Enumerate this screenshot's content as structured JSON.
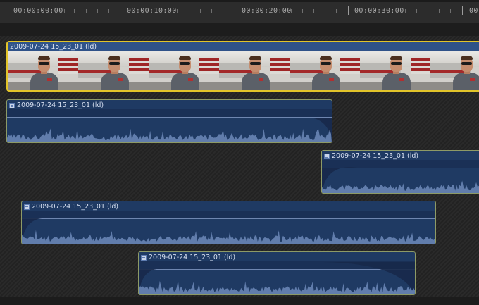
{
  "ruler": {
    "timecodes": [
      "00:00:00:00",
      "00:00:10:00",
      "00:00:20:00",
      "00:00:30:00",
      "00"
    ]
  },
  "video_clip": {
    "name": "2009-07-24 15_23_01 (ld)",
    "thumbnail_count": 7
  },
  "audio_clips": [
    {
      "name": "2009-07-24 15_23_01 (ld)"
    },
    {
      "name": "2009-07-24 15_23_01 (ld)"
    },
    {
      "name": "2009-07-24 15_23_01 (ld)"
    },
    {
      "name": "2009-07-24 15_23_01 (ld)"
    }
  ],
  "colors": {
    "selected_border": "#e2c42a",
    "clip_border": "#8d9a66",
    "audio_fill": "#1f3a63",
    "waveform": "#6d89b8"
  },
  "icons": {
    "clip_type": "filmstrip-icon"
  }
}
